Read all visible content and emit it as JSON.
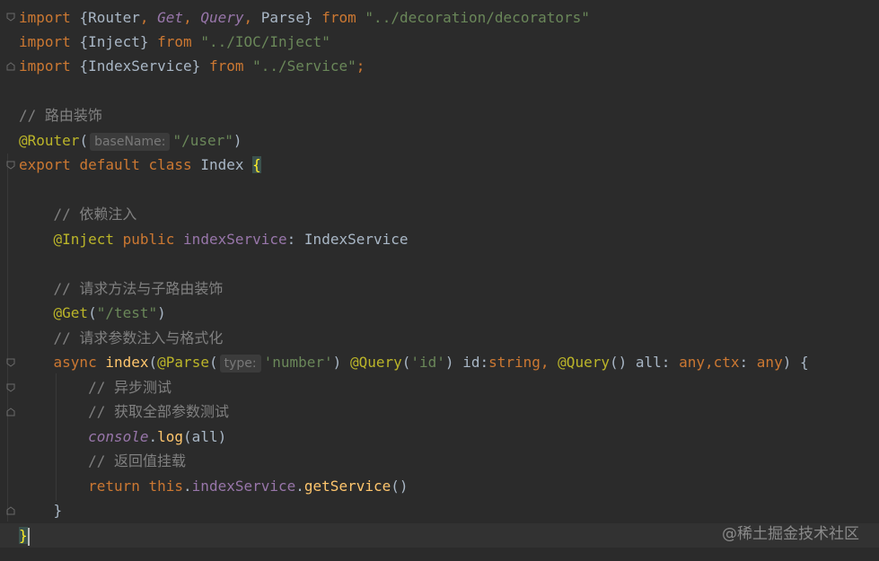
{
  "editor": {
    "lines": [
      {
        "import": "import",
        "open": "{",
        "router": "Router",
        "comma1": ",",
        "get": "Get",
        "comma2": ",",
        "query": "Query",
        "comma3": ",",
        "parse": "Parse",
        "close": "}",
        "from": "from",
        "path": "\"../decoration/decorators\""
      },
      {
        "import": "import",
        "open": "{",
        "name": "Inject",
        "close": "}",
        "from": "from",
        "path": "\"../IOC/Inject\""
      },
      {
        "import": "import",
        "open": "{",
        "name": "IndexService",
        "close": "}",
        "from": "from",
        "path": "\"../Service\"",
        "semi": ";"
      },
      {
        "comment": "// 路由装饰"
      },
      {
        "decorator": "@Router",
        "paren_open": "(",
        "hint": "baseName:",
        "arg": "\"/user\"",
        "paren_close": ")"
      },
      {
        "export": "export",
        "default": "default",
        "class": "class",
        "name": "Index",
        "brace": "{"
      },
      {
        "comment": "// 依赖注入"
      },
      {
        "decorator": "@Inject",
        "public": "public",
        "field": "indexService",
        "colon": ":",
        "type": "IndexService"
      },
      {
        "comment": "// 请求方法与子路由装饰"
      },
      {
        "decorator": "@Get",
        "paren_open": "(",
        "arg": "\"/test\"",
        "paren_close": ")"
      },
      {
        "comment": "// 请求参数注入与格式化"
      },
      {
        "async": "async",
        "method": "index",
        "p1": "(",
        "parse": "@Parse",
        "p2": "(",
        "hint": "type:",
        "num": "'number'",
        "p3": ")",
        "query1": "@Query",
        "p4": "(",
        "id_str": "'id'",
        "p5": ")",
        "id_name": "id",
        "colon1": ":",
        "string_type": "string",
        "comma1": ",",
        "query2": "@Query",
        "p6": "()",
        "all_name": "all",
        "colon2": ":",
        "any1": "any",
        "comma2": ",",
        "ctx": "ctx",
        "colon3": ":",
        "any2": "any",
        "p7": ")",
        "brace": "{"
      },
      {
        "comment": "// 异步测试"
      },
      {
        "comment": "// 获取全部参数测试"
      },
      {
        "console": "console",
        "dot": ".",
        "log": "log",
        "args": "(all)"
      },
      {
        "comment": "// 返回值挂载"
      },
      {
        "return": "return",
        "this": "this",
        "dot1": ".",
        "field": "indexService",
        "dot2": ".",
        "method": "getService",
        "args": "()"
      },
      {
        "brace": "}"
      },
      {
        "brace": "}"
      }
    ]
  },
  "watermark": "@稀土掘金技术社区",
  "colors": {
    "background": "#2b2b2b",
    "keyword": "#cc7832",
    "string": "#6a8759",
    "annotation": "#bbb529",
    "comment": "#808080",
    "function": "#ffc66d",
    "field": "#9876aa",
    "text": "#a9b7c6"
  },
  "icons": [
    "fold-icon"
  ]
}
